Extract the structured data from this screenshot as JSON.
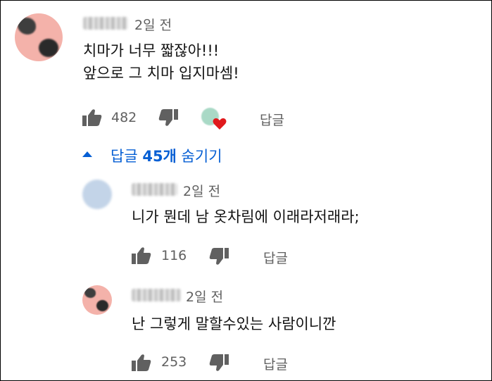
{
  "comments": [
    {
      "username": "박잘떼",
      "time": "2일 전",
      "lines": [
        "치마가 너무 짧잖아!!!",
        "앞으로 그 치마 입지마셈!"
      ],
      "likes": "482",
      "reply_label": "답글",
      "creator_heart": true
    }
  ],
  "toggle_replies": {
    "prefix": "답글 ",
    "count": "45개",
    "suffix": " 숨기기"
  },
  "replies": [
    {
      "time": "2일 전",
      "text": "니가 뭔데 남 옷차림에 이래라저래라;",
      "likes": "116",
      "reply_label": "답글"
    },
    {
      "username": "박잘떼",
      "time": "2일 전",
      "text": "난 그렇게 말할수있는 사람이니깐",
      "likes": "253",
      "reply_label": "답글"
    }
  ],
  "colors": {
    "link_blue": "#065fd4",
    "meta_gray": "#606060",
    "heart_red": "#e0191c",
    "avatar_pink": "#f4b2aa"
  },
  "icons": [
    "thumbs-up-icon",
    "thumbs-down-icon",
    "heart-icon",
    "chevron-up-icon"
  ]
}
